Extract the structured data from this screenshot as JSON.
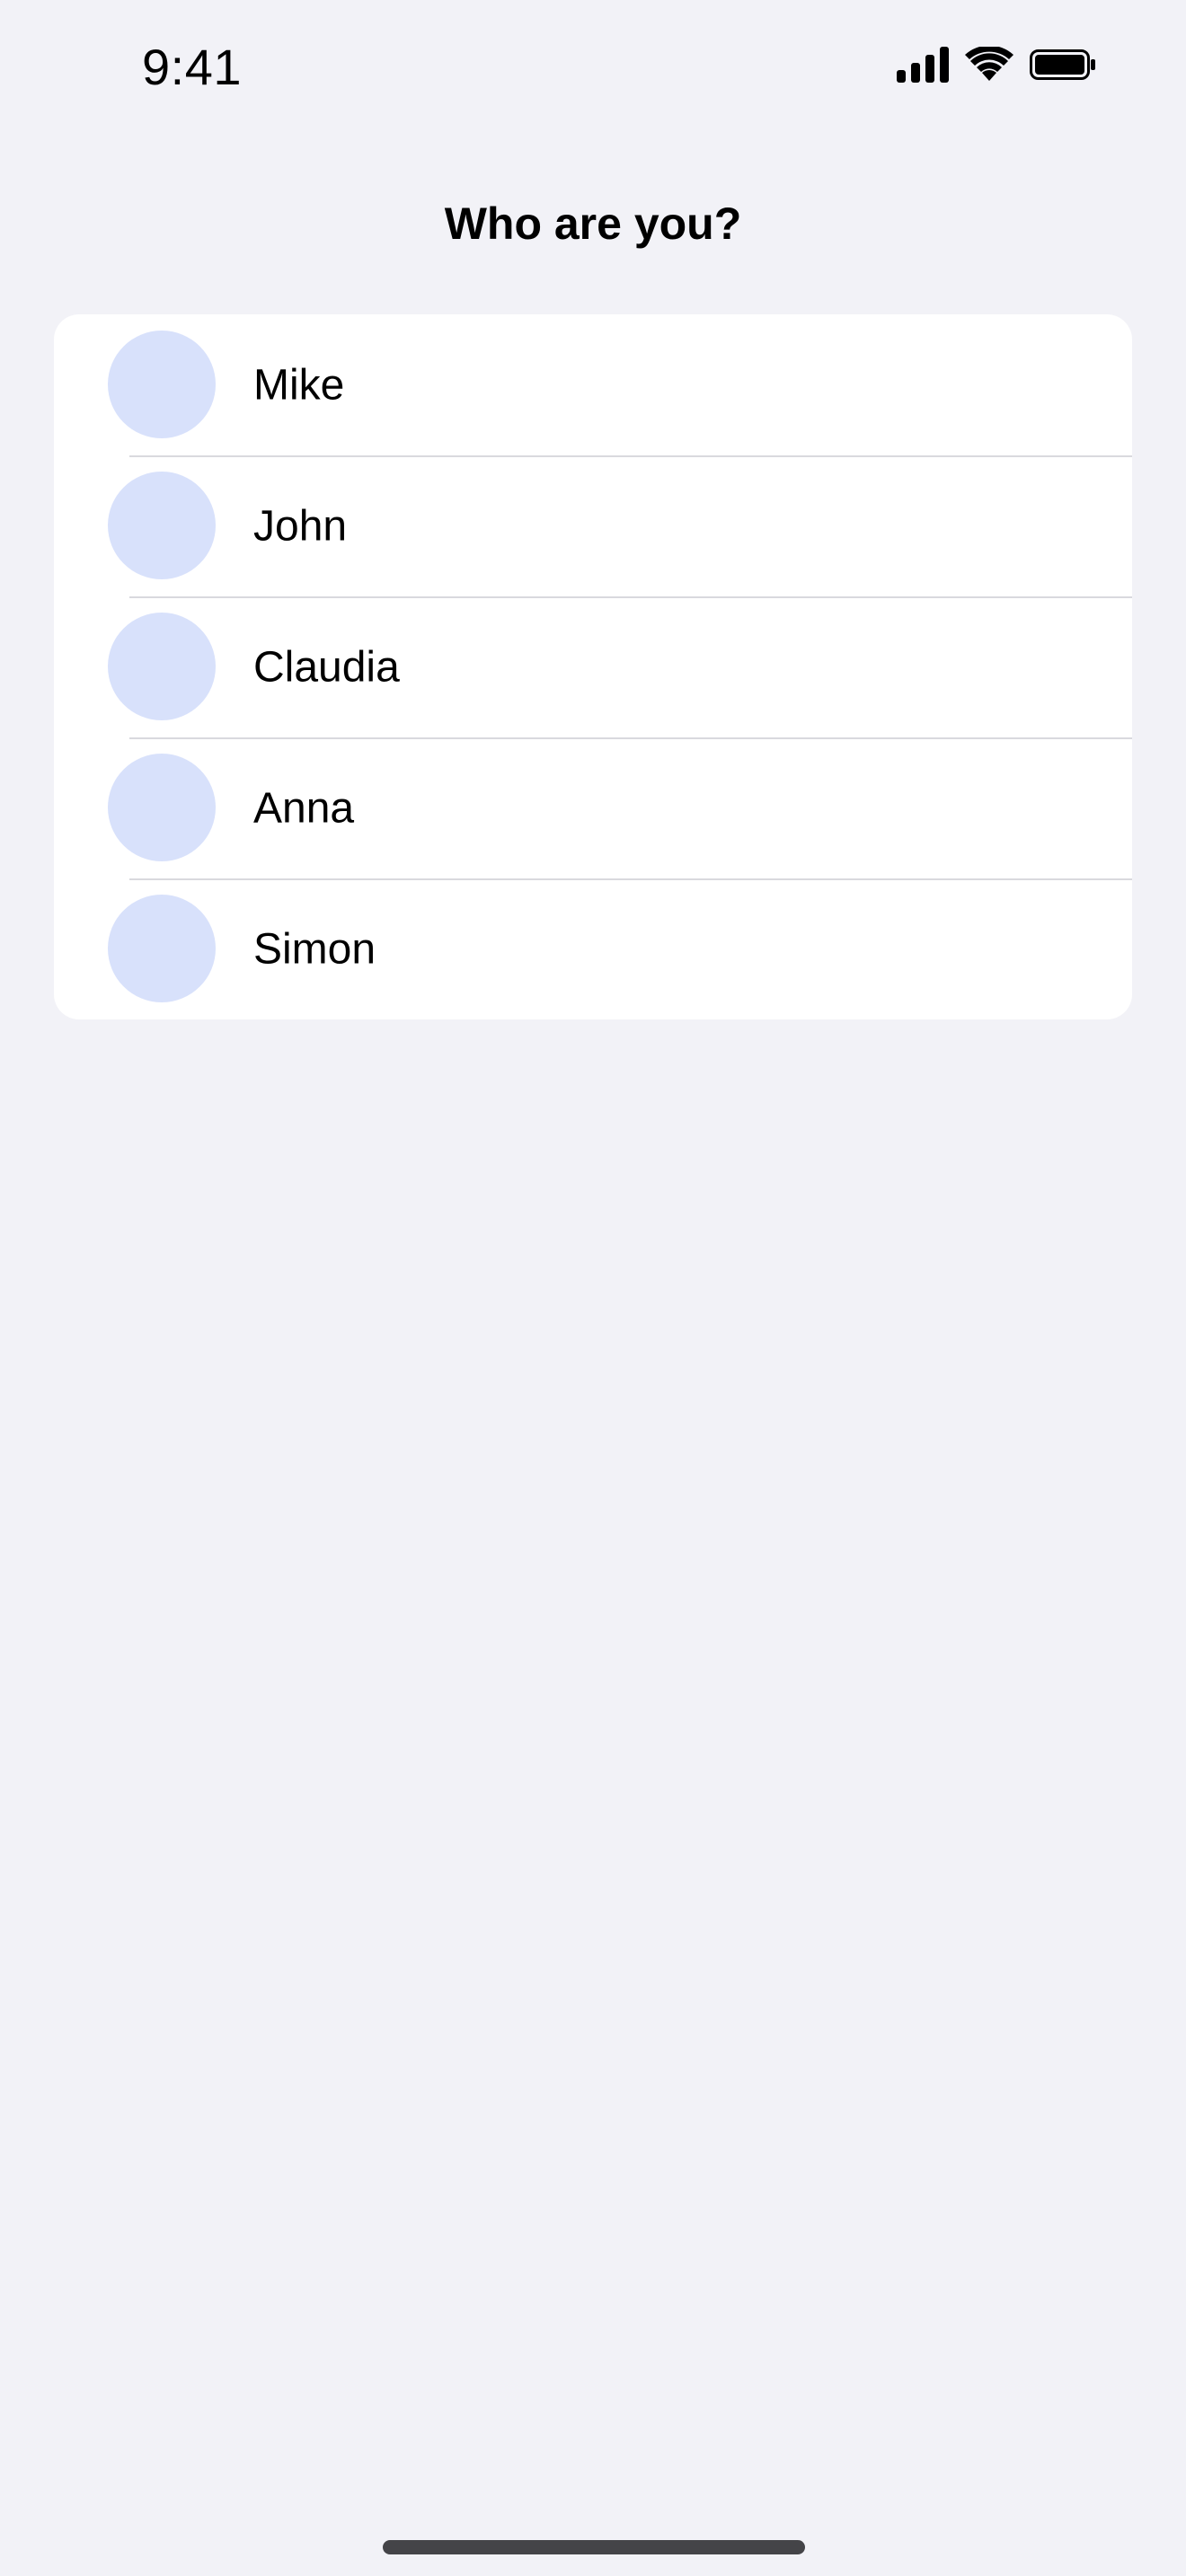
{
  "status_bar": {
    "time": "9:41",
    "icons": [
      "cellular-signal-icon",
      "wifi-icon",
      "battery-icon"
    ]
  },
  "screen": {
    "title": "Who are you?"
  },
  "people": [
    {
      "name": "Mike"
    },
    {
      "name": "John"
    },
    {
      "name": "Claudia"
    },
    {
      "name": "Anna"
    },
    {
      "name": "Simon"
    }
  ],
  "colors": {
    "background": "#f2f2f7",
    "card": "#ffffff",
    "avatar": "#d8e1fb",
    "separator": "#d9d9de",
    "text": "#000000",
    "home_indicator": "#444448"
  }
}
